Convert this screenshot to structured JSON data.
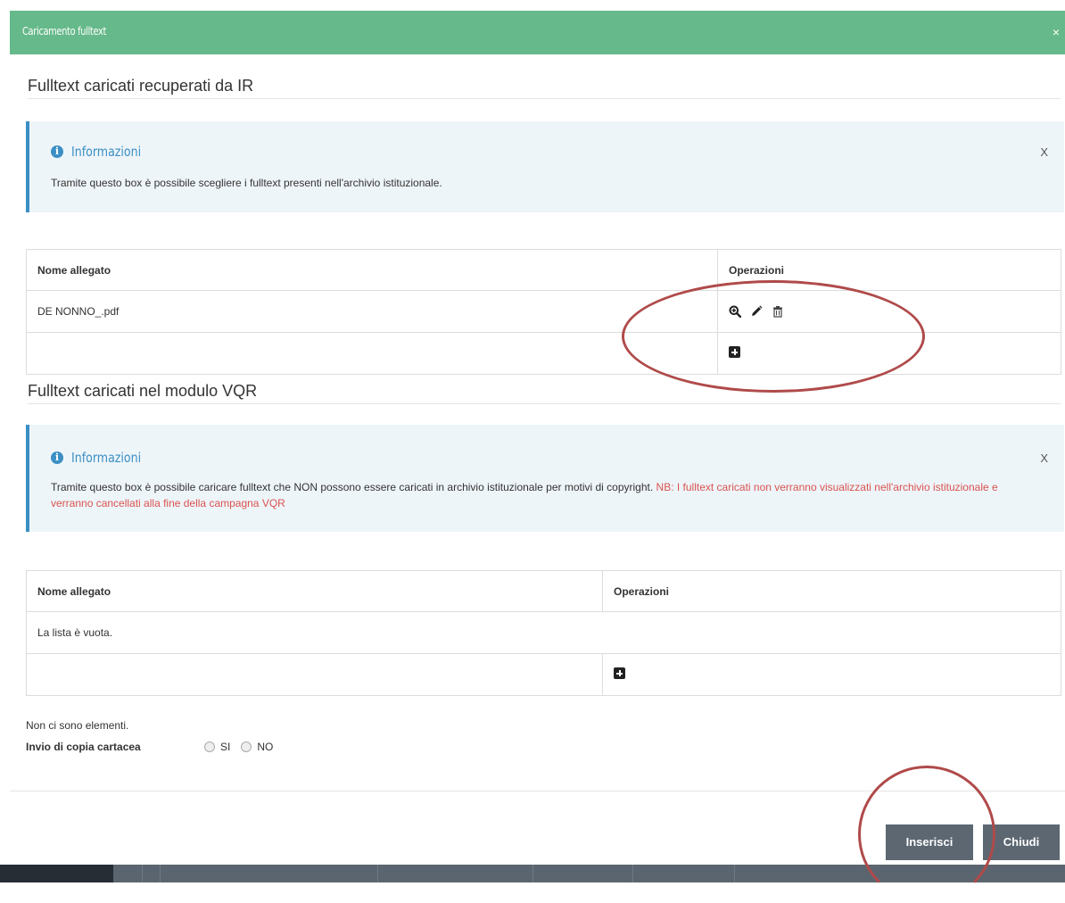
{
  "modal": {
    "title": "Caricamento fulltext",
    "close": "×"
  },
  "section_ir": {
    "title": "Fulltext caricati recuperati da IR",
    "info": {
      "heading": "Informazioni",
      "text": "Tramite questo box è possibile scegliere i fulltext presenti nell'archivio istituzionale.",
      "dismiss": "X"
    },
    "table": {
      "columns": [
        "Nome allegato",
        "Operazioni"
      ],
      "rows": [
        {
          "name": "DE NONNO_.pdf"
        }
      ]
    }
  },
  "section_vqr": {
    "title": "Fulltext caricati nel modulo VQR",
    "info": {
      "heading": "Informazioni",
      "text": "Tramite questo box è possibile caricare fulltext che NON possono essere caricati in archivio istituzionale per motivi di copyright. ",
      "warning": "NB: I fulltext caricati non verranno visualizzati nell'archivio istituzionale e verranno cancellati alla fine della campagna VQR",
      "dismiss": "X"
    },
    "table": {
      "columns": [
        "Nome allegato",
        "Operazioni"
      ],
      "empty_text": "La lista è vuota."
    }
  },
  "footer": {
    "note": "Non ci sono elementi.",
    "paper_copy_label": "Invio di copia cartacea",
    "options": [
      "SI",
      "NO"
    ]
  },
  "buttons": {
    "insert": "Inserisci",
    "close": "Chiudi"
  },
  "colors": {
    "header_green": "#66b98a",
    "info_blue": "#3b8fc4",
    "warning_red": "#d9534f",
    "button_gray": "#5c6772",
    "annotation_red": "#b04a4a"
  }
}
